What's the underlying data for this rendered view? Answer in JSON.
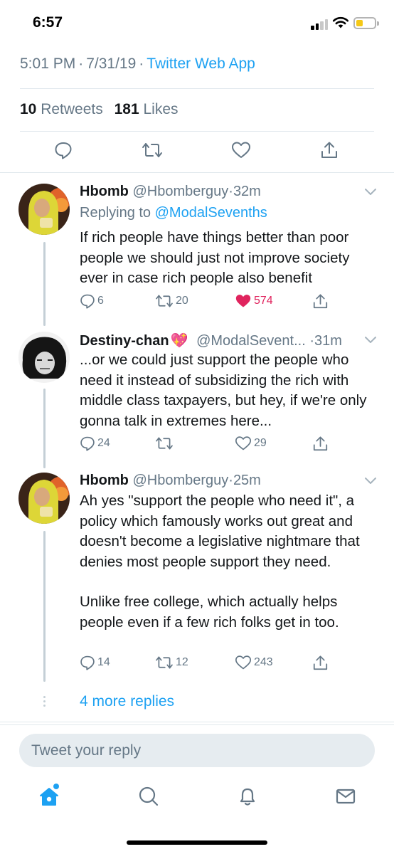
{
  "status_bar": {
    "time": "6:57"
  },
  "tweet": {
    "time": "5:01 PM",
    "date": "7/31/19",
    "source": "Twitter Web App",
    "retweet_count": "10",
    "retweet_label": "Retweets",
    "like_count": "181",
    "like_label": "Likes",
    "actions": [
      "reply-icon",
      "retweet-icon",
      "like-icon",
      "share-icon"
    ]
  },
  "replies": [
    {
      "name": "Hbomb",
      "handle": "@Hbomberguy",
      "time": "32m",
      "replying_prefix": "Replying to",
      "replying_to": "@ModalSevenths",
      "text": [
        "If rich people have things better than poor people we should just not improve society ever in case rich people also benefit"
      ],
      "reply_count": "6",
      "retweet_count": "20",
      "like_count": "574",
      "liked": true
    },
    {
      "name": "Destiny-chan",
      "name_emoji": "💖",
      "handle": "@ModalSevent...",
      "time": "31m",
      "text": [
        "...or we could just support the people who need it instead of subsidizing the rich with middle class taxpayers, but hey, if we're only gonna talk in extremes here..."
      ],
      "reply_count": "24",
      "retweet_count": "",
      "like_count": "29",
      "liked": false
    },
    {
      "name": "Hbomb",
      "handle": "@Hbomberguy",
      "time": "25m",
      "text": [
        "Ah yes \"support the people who need it\", a policy which famously works out great and doesn't become a legislative nightmare that denies most people support they need.",
        "Unlike free college, which actually helps people even if a few rich folks get in too."
      ],
      "reply_count": "14",
      "retweet_count": "12",
      "like_count": "243",
      "liked": false
    }
  ],
  "more_replies": "4 more replies",
  "reply_box": {
    "placeholder": "Tweet your reply"
  },
  "tab_bar": [
    "home-icon",
    "search-icon",
    "notifications-icon",
    "messages-icon"
  ],
  "colors": {
    "accent": "#1da1f2",
    "liked": "#e0245e",
    "secondary_text": "#657786",
    "battery": "#f5c816"
  }
}
